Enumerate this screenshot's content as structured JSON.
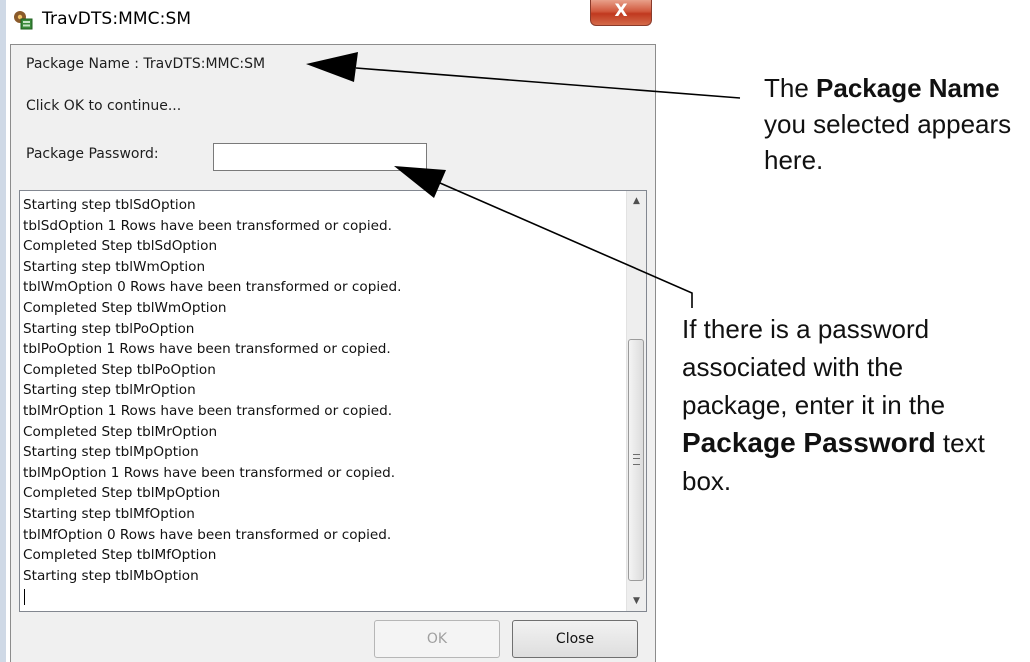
{
  "window": {
    "title": "TravDTS:MMC:SM",
    "close_glyph": "X",
    "app_icon": "app-icon",
    "close_icon": "close-icon"
  },
  "dialog": {
    "package_name_line": "Package Name : TravDTS:MMC:SM",
    "instruction": "Click OK to continue...",
    "password_label": "Package Password:",
    "password_value": "",
    "log_lines": [
      "Starting step tblSdOption",
      "tblSdOption 1 Rows have been transformed or copied.",
      "Completed Step tblSdOption",
      "Starting step tblWmOption",
      "tblWmOption 0 Rows have been transformed or copied.",
      "Completed Step tblWmOption",
      "Starting step tblPoOption",
      "tblPoOption 1 Rows have been transformed or copied.",
      "Completed Step tblPoOption",
      "Starting step tblMrOption",
      "tblMrOption 1 Rows have been transformed or copied.",
      "Completed Step tblMrOption",
      "Starting step tblMpOption",
      "tblMpOption 1 Rows have been transformed or copied.",
      "Completed Step tblMpOption",
      "Starting step tblMfOption",
      "tblMfOption 0 Rows have been transformed or copied.",
      "Completed Step tblMfOption",
      "Starting step tblMbOption"
    ],
    "ok_label": "OK",
    "ok_enabled": false,
    "close_label": "Close"
  },
  "callouts": {
    "package_name": {
      "pre": "The ",
      "bold": "Package Name",
      "post": " you selected appears here."
    },
    "password": {
      "pre": "If there is a password associated with the package, enter it in the ",
      "bold": "Package Password",
      "post": " text box."
    }
  },
  "colors": {
    "dialog_bg": "#f0f0f0",
    "close_button": "#c0391f",
    "arrow": "#000000"
  }
}
